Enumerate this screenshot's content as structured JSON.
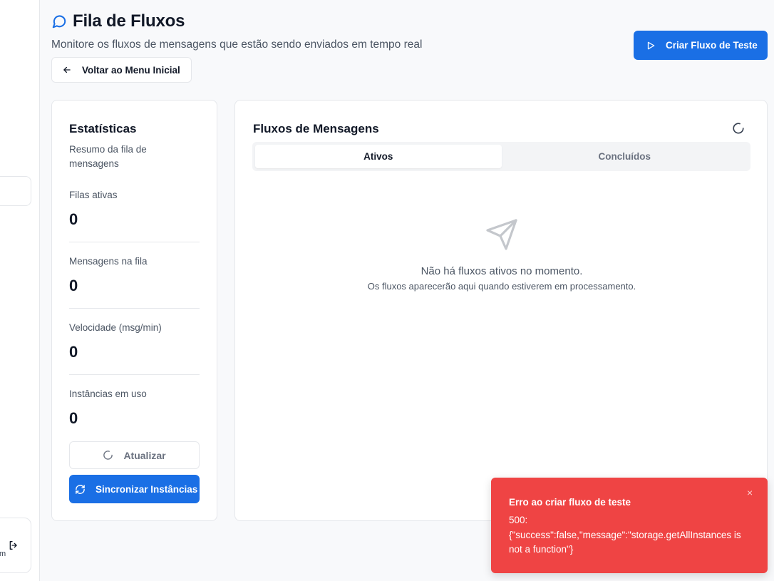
{
  "header": {
    "title": "Fila de Fluxos",
    "subtitle": "Monitore os fluxos de mensagens que estão sendo enviados em tempo real",
    "back_label": "Voltar ao Menu Inicial",
    "create_test_label": "Criar Fluxo de Teste"
  },
  "sidebar": {
    "cut_text": "m"
  },
  "stats": {
    "title": "Estatísticas",
    "description": "Resumo da fila de mensagens",
    "items": [
      {
        "label": "Filas ativas",
        "value": "0"
      },
      {
        "label": "Mensagens na fila",
        "value": "0"
      },
      {
        "label": "Velocidade (msg/min)",
        "value": "0"
      },
      {
        "label": "Instâncias em uso",
        "value": "0"
      }
    ],
    "update_label": "Atualizar",
    "sync_label": "Sincronizar Instâncias"
  },
  "flows": {
    "title": "Fluxos de Mensagens",
    "tabs": [
      {
        "label": "Ativos",
        "active": true
      },
      {
        "label": "Concluídos",
        "active": false
      }
    ],
    "empty_title": "Não há fluxos ativos no momento.",
    "empty_subtitle": "Os fluxos aparecerão aqui quando estiverem em processamento."
  },
  "toast": {
    "title": "Erro ao criar fluxo de teste",
    "message": "500: {\"success\":false,\"message\":\"storage.getAllInstances is not a function\"}",
    "close_symbol": "×"
  },
  "colors": {
    "primary": "#1a6fe5",
    "error": "#ef4444",
    "background": "#f8f9fb"
  }
}
